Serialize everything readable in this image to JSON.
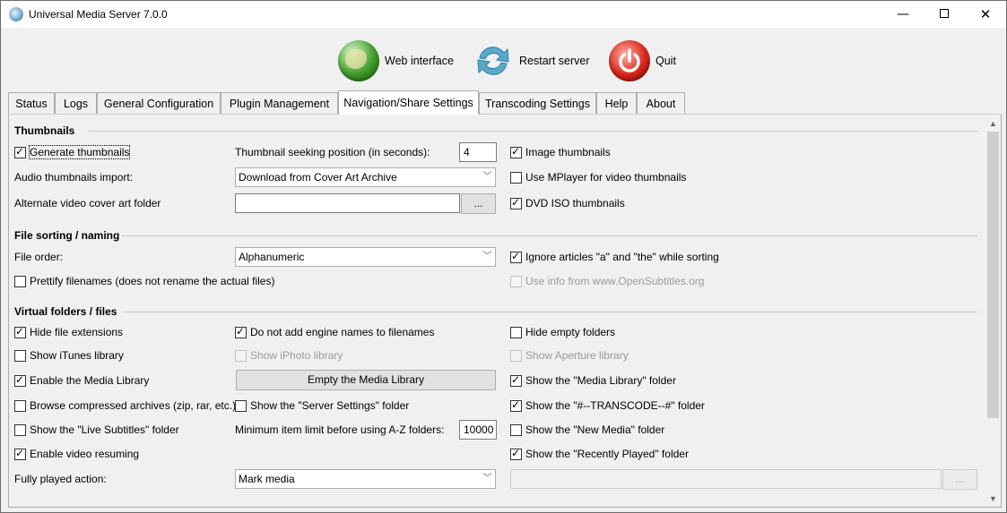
{
  "window": {
    "title": "Universal Media Server 7.0.0",
    "minimize": "—",
    "close": "✕"
  },
  "toolbar": {
    "web": "Web interface",
    "restart": "Restart server",
    "quit": "Quit"
  },
  "tabs": [
    "Status",
    "Logs",
    "General Configuration",
    "Plugin Management",
    "Navigation/Share Settings",
    "Transcoding Settings",
    "Help",
    "About"
  ],
  "active_tab": "Navigation/Share Settings",
  "scrollbar": {
    "up": "▲",
    "down": "▼"
  },
  "thumbnails": {
    "heading": "Thumbnails",
    "generate": {
      "label": "Generate thumbnails",
      "checked": true
    },
    "seek_label": "Thumbnail seeking position (in seconds):",
    "seek_value": "4",
    "image_thumbs": {
      "label": "Image thumbnails",
      "checked": true
    },
    "audio_import_label": "Audio thumbnails import:",
    "audio_import_value": "Download from Cover Art Archive",
    "mplayer": {
      "label": "Use MPlayer for video thumbnails",
      "checked": false
    },
    "alt_cover_label": "Alternate video cover art folder",
    "alt_cover_value": "",
    "browse_button": "...",
    "dvd_iso": {
      "label": "DVD ISO thumbnails",
      "checked": true
    }
  },
  "sorting": {
    "heading": "File sorting / naming",
    "order_label": "File order:",
    "order_value": "Alphanumeric",
    "ignore_articles": {
      "label": "Ignore articles \"a\" and \"the\" while sorting",
      "checked": true
    },
    "prettify": {
      "label": "Prettify filenames (does not rename the actual files)",
      "checked": false
    },
    "opensubtitles": {
      "label": "Use info from www.OpenSubtitles.org",
      "checked": false,
      "disabled": true
    }
  },
  "virtual": {
    "heading": "Virtual folders / files",
    "hide_ext": {
      "label": "Hide file extensions",
      "checked": true
    },
    "no_engine": {
      "label": "Do not add engine names to filenames",
      "checked": true
    },
    "hide_empty": {
      "label": "Hide empty folders",
      "checked": false
    },
    "itunes": {
      "label": "Show iTunes library",
      "checked": false
    },
    "iphoto": {
      "label": "Show iPhoto library",
      "checked": false,
      "disabled": true
    },
    "aperture": {
      "label": "Show Aperture library",
      "checked": false,
      "disabled": true
    },
    "media_library": {
      "label": "Enable the Media Library",
      "checked": true
    },
    "empty_library_button": "Empty the Media Library",
    "show_media_library": {
      "label": "Show the \"Media Library\" folder",
      "checked": true
    },
    "compressed": {
      "label": "Browse compressed archives (zip, rar, etc.)",
      "checked": false
    },
    "server_settings": {
      "label": "Show the \"Server Settings\" folder",
      "checked": false
    },
    "transcode_folder": {
      "label": "Show the \"#--TRANSCODE--#\" folder",
      "checked": true
    },
    "live_subs": {
      "label": "Show the \"Live Subtitles\" folder",
      "checked": false
    },
    "az_label": "Minimum item limit before using A-Z folders:",
    "az_value": "10000",
    "new_media": {
      "label": "Show the \"New Media\" folder",
      "checked": false
    },
    "resume": {
      "label": "Enable video resuming",
      "checked": true
    },
    "recently_played": {
      "label": "Show the \"Recently Played\" folder",
      "checked": true
    },
    "fully_played_label": "Fully played action:",
    "fully_played_value": "Mark media",
    "fully_played_path": "",
    "fully_played_browse": "..."
  }
}
